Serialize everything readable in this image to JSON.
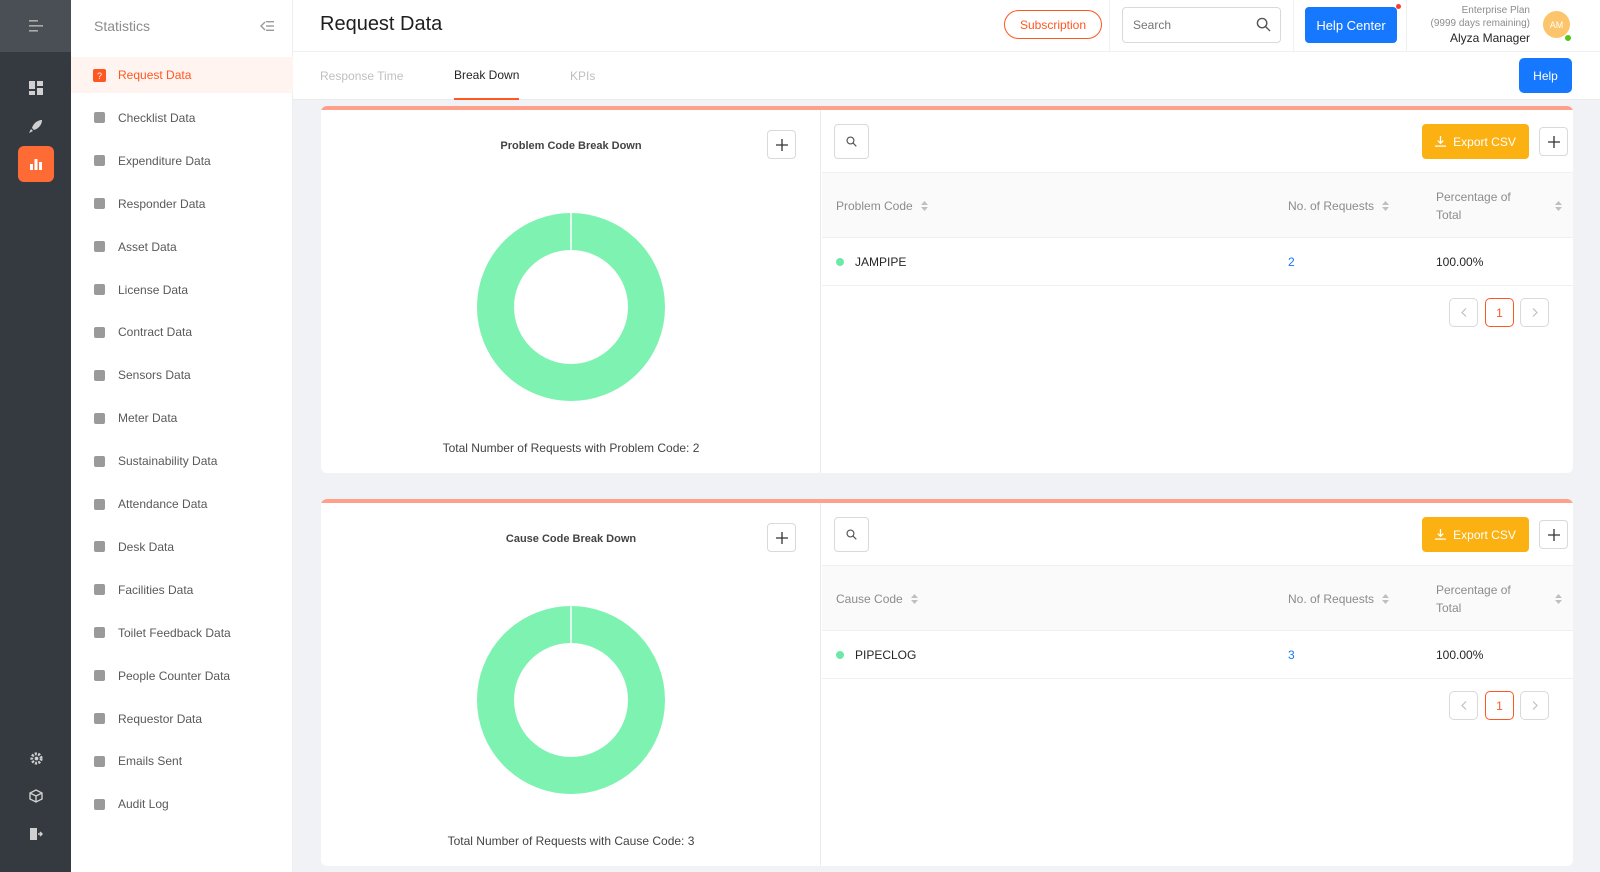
{
  "sidebar": {
    "title": "Statistics",
    "items": [
      {
        "label": "Request Data",
        "icon": "question-square-icon",
        "active": true
      },
      {
        "label": "Checklist Data",
        "icon": "checklist-icon"
      },
      {
        "label": "Expenditure Data",
        "icon": "wallet-icon"
      },
      {
        "label": "Responder Data",
        "icon": "users-icon"
      },
      {
        "label": "Asset Data",
        "icon": "box-icon"
      },
      {
        "label": "License Data",
        "icon": "shield-icon"
      },
      {
        "label": "Contract Data",
        "icon": "document-icon"
      },
      {
        "label": "Sensors Data",
        "icon": "rss-icon"
      },
      {
        "label": "Meter Data",
        "icon": "gauge-icon"
      },
      {
        "label": "Sustainability Data",
        "icon": "leaf-icon"
      },
      {
        "label": "Attendance Data",
        "icon": "check-square-icon"
      },
      {
        "label": "Desk Data",
        "icon": "desk-icon"
      },
      {
        "label": "Facilities Data",
        "icon": "calendar-plus-icon"
      },
      {
        "label": "Toilet Feedback Data",
        "icon": "list-icon"
      },
      {
        "label": "People Counter Data",
        "icon": "person-counter-icon"
      },
      {
        "label": "Requestor Data",
        "icon": "smile-icon"
      },
      {
        "label": "Emails Sent",
        "icon": "mail-icon"
      },
      {
        "label": "Audit Log",
        "icon": "log-icon"
      }
    ]
  },
  "header": {
    "title": "Request Data",
    "subscription_label": "Subscription",
    "search_placeholder": "Search",
    "help_center_label": "Help Center",
    "plan_name": "Enterprise Plan",
    "plan_remaining": "(9999 days remaining)",
    "user_name": "Alyza Manager",
    "avatar_initials": "AM"
  },
  "tabs": [
    {
      "label": "Response Time",
      "active": false
    },
    {
      "label": "Break Down",
      "active": true
    },
    {
      "label": "KPIs",
      "active": false
    }
  ],
  "help_label": "Help",
  "breakdowns": [
    {
      "chart_title": "Problem Code Break Down",
      "total_text": "Total Number of Requests with Problem Code: 2",
      "export_label": "Export CSV",
      "columns": [
        "Problem Code",
        "No. of Requests",
        "Percentage of Total"
      ],
      "rows": [
        {
          "code": "JAMPIPE",
          "count": "2",
          "percent": "100.00%"
        }
      ],
      "page": "1"
    },
    {
      "chart_title": "Cause Code Break Down",
      "total_text": "Total Number of Requests with Cause Code: 3",
      "export_label": "Export CSV",
      "columns": [
        "Cause Code",
        "No. of Requests",
        "Percentage of Total"
      ],
      "rows": [
        {
          "code": "PIPECLOG",
          "count": "3",
          "percent": "100.00%"
        }
      ],
      "page": "1"
    }
  ],
  "chart_data": [
    {
      "type": "pie",
      "title": "Problem Code Break Down",
      "categories": [
        "JAMPIPE"
      ],
      "values": [
        2
      ]
    },
    {
      "type": "pie",
      "title": "Cause Code Break Down",
      "categories": [
        "PIPECLOG"
      ],
      "values": [
        3
      ]
    }
  ],
  "colors": {
    "accent": "#ff5722",
    "primary": "#1677ff",
    "export": "#fbb111",
    "slice": "#7ef2b0",
    "card_accent": "#ffa08a"
  }
}
